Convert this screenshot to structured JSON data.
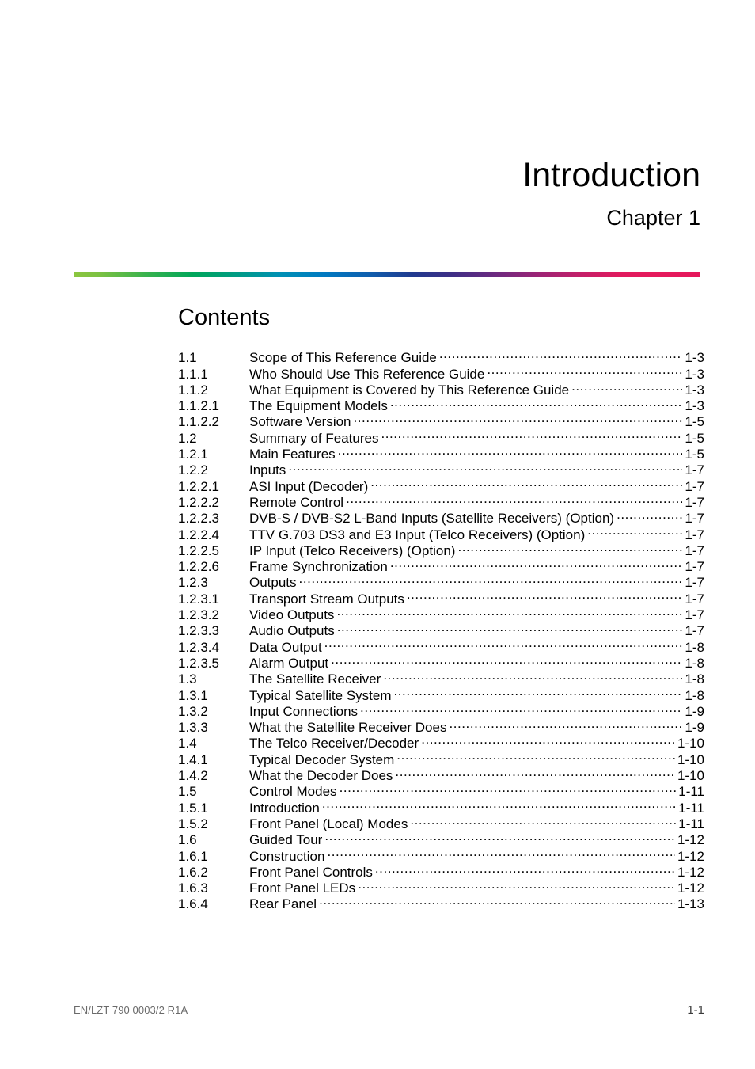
{
  "document": {
    "chapter_title": "Introduction",
    "chapter_number": "Chapter 1",
    "contents_heading": "Contents",
    "rule_gradient": {
      "start_color": "#8cc63f",
      "mid_green": "#00a65a",
      "mid_blue": "#0079c1",
      "mid_purple": "#3c2f86",
      "end_color": "#e5175b"
    }
  },
  "toc": {
    "entries": [
      {
        "number": "1.1",
        "title": "Scope of This Reference Guide",
        "page": "1-3"
      },
      {
        "number": "1.1.1",
        "title": "Who Should Use This Reference Guide",
        "page": "1-3"
      },
      {
        "number": "1.1.2",
        "title": "What Equipment is Covered by This Reference Guide",
        "page": "1-3"
      },
      {
        "number": "1.1.2.1",
        "title": "The Equipment Models",
        "page": "1-3"
      },
      {
        "number": "1.1.2.2",
        "title": "Software Version",
        "page": "1-5"
      },
      {
        "number": "1.2",
        "title": "Summary of Features",
        "page": "1-5"
      },
      {
        "number": "1.2.1",
        "title": "Main Features",
        "page": "1-5"
      },
      {
        "number": "1.2.2",
        "title": "Inputs",
        "page": "1-7"
      },
      {
        "number": "1.2.2.1",
        "title": "ASI Input (Decoder)",
        "page": "1-7"
      },
      {
        "number": "1.2.2.2",
        "title": "Remote Control",
        "page": "1-7"
      },
      {
        "number": "1.2.2.3",
        "title": "DVB-S / DVB-S2 L-Band Inputs (Satellite Receivers) (Option)",
        "page": "1-7"
      },
      {
        "number": "1.2.2.4",
        "title": "TTV G.703 DS3 and E3 Input (Telco Receivers) (Option)",
        "page": "1-7"
      },
      {
        "number": "1.2.2.5",
        "title": "IP Input (Telco Receivers) (Option)",
        "page": "1-7"
      },
      {
        "number": "1.2.2.6",
        "title": "Frame Synchronization",
        "page": "1-7"
      },
      {
        "number": "1.2.3",
        "title": "Outputs",
        "page": "1-7"
      },
      {
        "number": "1.2.3.1",
        "title": "Transport Stream Outputs",
        "page": "1-7"
      },
      {
        "number": "1.2.3.2",
        "title": "Video Outputs",
        "page": "1-7"
      },
      {
        "number": "1.2.3.3",
        "title": "Audio Outputs",
        "page": "1-7"
      },
      {
        "number": "1.2.3.4",
        "title": "Data Output",
        "page": "1-8"
      },
      {
        "number": "1.2.3.5",
        "title": "Alarm Output",
        "page": "1-8"
      },
      {
        "number": "1.3",
        "title": "The Satellite Receiver",
        "page": "1-8"
      },
      {
        "number": "1.3.1",
        "title": "Typical Satellite System",
        "page": "1-8"
      },
      {
        "number": "1.3.2",
        "title": "Input Connections",
        "page": "1-9"
      },
      {
        "number": "1.3.3",
        "title": "What the Satellite Receiver Does",
        "page": "1-9"
      },
      {
        "number": "1.4",
        "title": "The Telco Receiver/Decoder",
        "page": "1-10"
      },
      {
        "number": "1.4.1",
        "title": "Typical Decoder System",
        "page": "1-10"
      },
      {
        "number": "1.4.2",
        "title": "What the Decoder Does",
        "page": "1-10"
      },
      {
        "number": "1.5",
        "title": "Control Modes",
        "page": "1-11"
      },
      {
        "number": "1.5.1",
        "title": "Introduction",
        "page": "1-11"
      },
      {
        "number": "1.5.2",
        "title": "Front Panel (Local) Modes",
        "page": "1-11"
      },
      {
        "number": "1.6",
        "title": "Guided Tour",
        "page": "1-12"
      },
      {
        "number": "1.6.1",
        "title": "Construction",
        "page": "1-12"
      },
      {
        "number": "1.6.2",
        "title": "Front Panel Controls",
        "page": "1-12"
      },
      {
        "number": "1.6.3",
        "title": "Front Panel LEDs",
        "page": "1-12"
      },
      {
        "number": "1.6.4",
        "title": "Rear Panel",
        "page": "1-13"
      }
    ]
  },
  "footer": {
    "doc_id": "EN/LZT 790 0003/2 R1A",
    "page_number": "1-1"
  }
}
